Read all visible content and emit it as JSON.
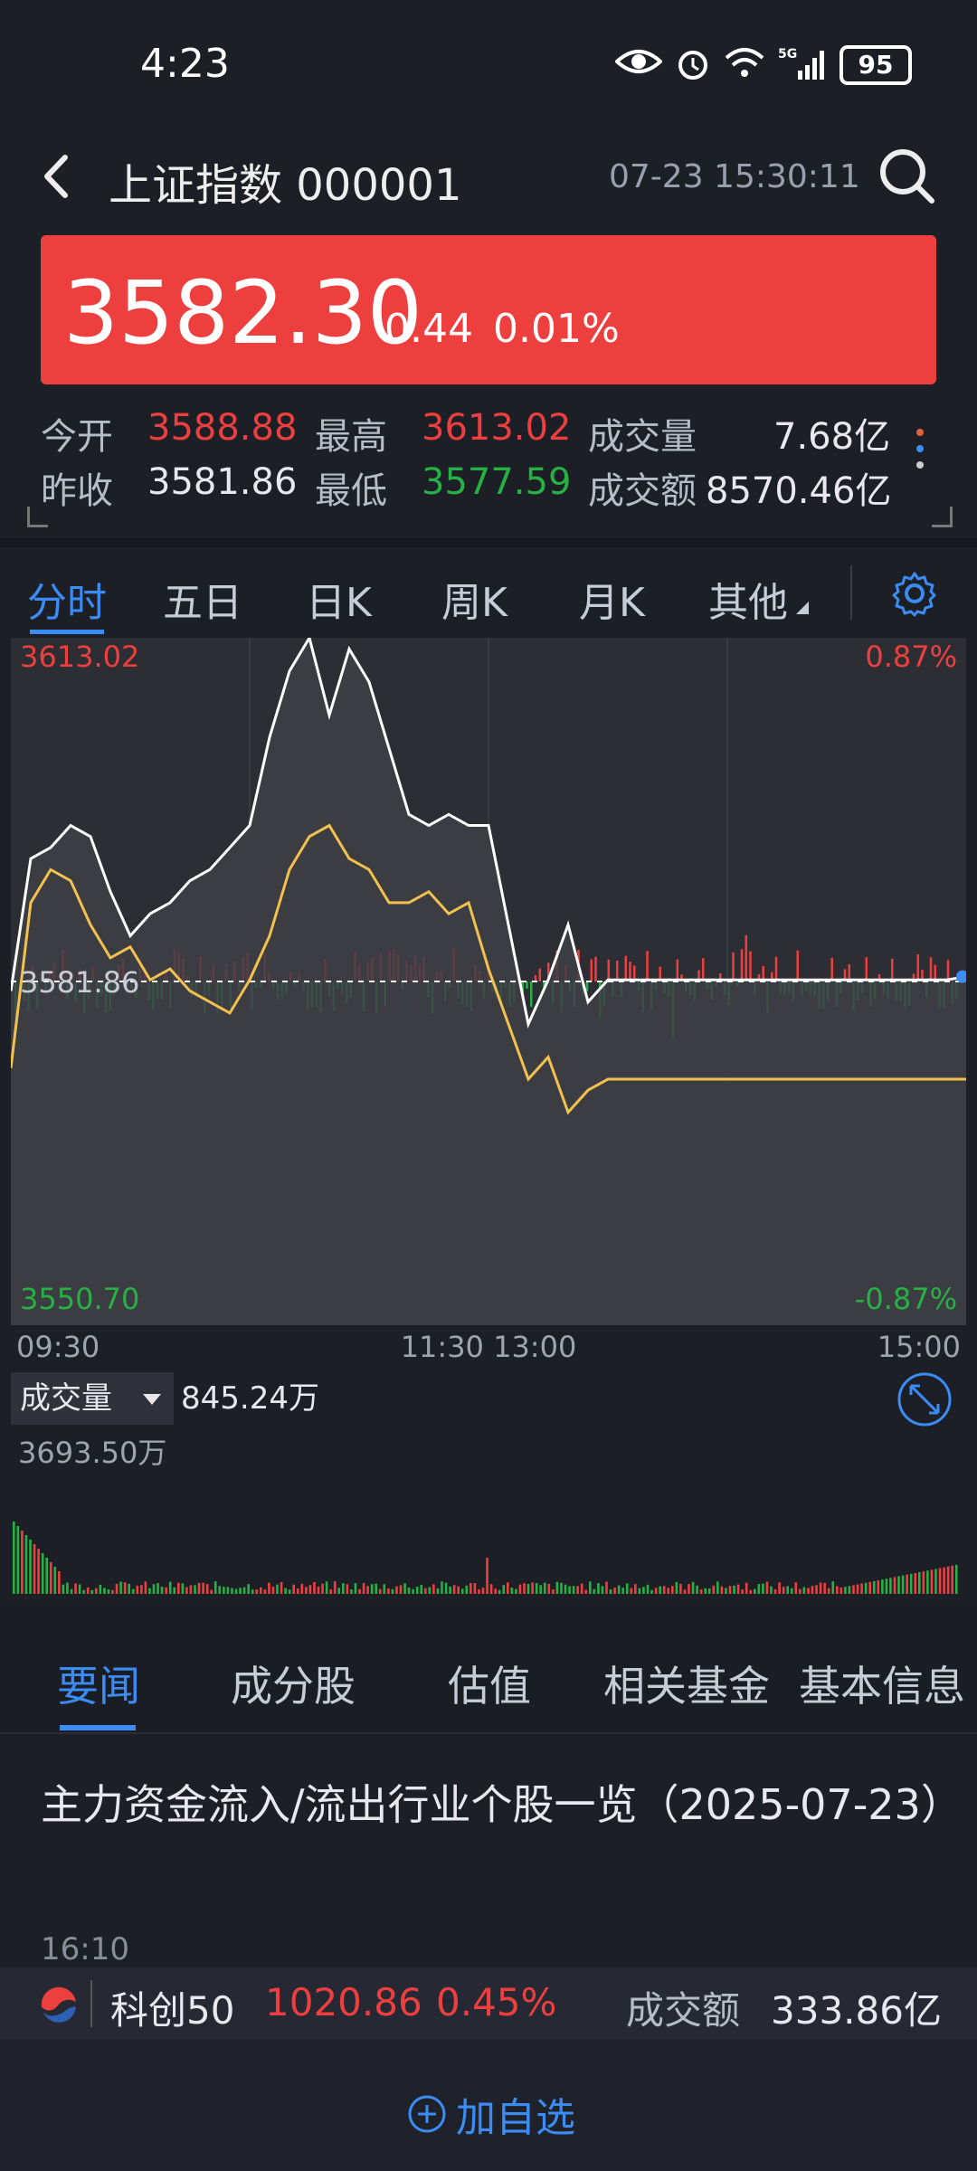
{
  "status_bar": {
    "time": "4:23",
    "battery": "95"
  },
  "header": {
    "title": "上证指数 000001",
    "datetime": "07-23 15:30:11"
  },
  "quote": {
    "price": "3582.30",
    "change": "0.44",
    "change_pct": "0.01%"
  },
  "stats": {
    "open_label": "今开",
    "open": "3588.88",
    "high_label": "最高",
    "high": "3613.02",
    "volume_label": "成交量",
    "volume": "7.68亿",
    "prev_close_label": "昨收",
    "prev_close": "3581.86",
    "low_label": "最低",
    "low": "3577.59",
    "amount_label": "成交额",
    "amount": "8570.46亿"
  },
  "period_tabs": [
    "分时",
    "五日",
    "日K",
    "周K",
    "月K",
    "其他"
  ],
  "chart_data": {
    "type": "line",
    "price_ticks": {
      "top": "3613.02",
      "mid": "3581.86",
      "bottom": "3550.70"
    },
    "pct_ticks": {
      "top": "0.87%",
      "bottom": "-0.87%"
    },
    "time_ticks": [
      "09:30",
      "11:30 13:00",
      "15:00"
    ],
    "ylim": [
      3550.7,
      3613.02
    ],
    "series": [
      {
        "color": "#ffffff",
        "x": [
          0,
          5,
          10,
          15,
          20,
          25,
          30,
          35,
          40,
          45,
          50,
          55,
          60,
          65,
          70,
          75,
          80,
          85,
          90,
          95,
          100,
          105,
          110,
          115,
          120,
          125,
          130,
          135,
          140,
          145,
          150,
          155,
          160,
          165,
          170,
          175,
          180,
          185,
          190,
          195,
          200,
          205,
          210,
          215,
          220,
          225,
          230,
          235,
          240
        ],
        "values": [
          3581,
          3593,
          3594,
          3596,
          3595,
          3590,
          3586,
          3588,
          3589,
          3591,
          3592,
          3594,
          3596,
          3604,
          3610,
          3613,
          3606,
          3612,
          3609,
          3603,
          3597,
          3596,
          3597,
          3596,
          3596,
          3587,
          3578,
          3582,
          3587,
          3580,
          3582,
          3582,
          3582,
          3582,
          3582,
          3582,
          3582,
          3582,
          3582,
          3582,
          3582,
          3582,
          3582,
          3582,
          3582,
          3582,
          3582,
          3582,
          3582.3
        ]
      },
      {
        "color": "#f2c14e",
        "x": [
          0,
          5,
          10,
          15,
          20,
          25,
          30,
          35,
          40,
          45,
          50,
          55,
          60,
          65,
          70,
          75,
          80,
          85,
          90,
          95,
          100,
          105,
          110,
          115,
          120,
          125,
          130,
          135,
          140,
          145,
          150,
          155,
          160,
          165,
          170,
          175,
          180,
          185,
          190,
          195,
          200,
          205,
          210,
          215,
          220,
          225,
          230,
          235,
          240
        ],
        "values": [
          3574,
          3589,
          3592,
          3591,
          3587,
          3584,
          3585,
          3582,
          3583,
          3581,
          3580,
          3579,
          3582,
          3586,
          3592,
          3595,
          3596,
          3593,
          3592,
          3589,
          3589,
          3590,
          3588,
          3589,
          3583,
          3578,
          3573,
          3575,
          3570,
          3572,
          3573,
          3573,
          3573,
          3573,
          3573,
          3573,
          3573,
          3573,
          3573,
          3573,
          3573,
          3573,
          3573,
          3573,
          3573,
          3573,
          3573,
          3573,
          3573
        ]
      }
    ]
  },
  "volume_panel": {
    "label": "成交量",
    "current": "845.24万",
    "max": "3693.50万"
  },
  "news_tabs": [
    "要闻",
    "成分股",
    "估值",
    "相关基金",
    "基本信息"
  ],
  "news": {
    "title": "主力资金流入/流出行业个股一览（2025-07-23）",
    "time": "16:10"
  },
  "ticker": {
    "name": "科创50",
    "price": "1020.86",
    "pct": "0.45%",
    "amount_label": "成交额",
    "amount": "333.86亿"
  },
  "bottom_action": {
    "label": "加自选"
  },
  "colors": {
    "up": "#ee3f3f",
    "down": "#27b043",
    "accent": "#3b8cf5",
    "bg": "#1d1f27"
  }
}
